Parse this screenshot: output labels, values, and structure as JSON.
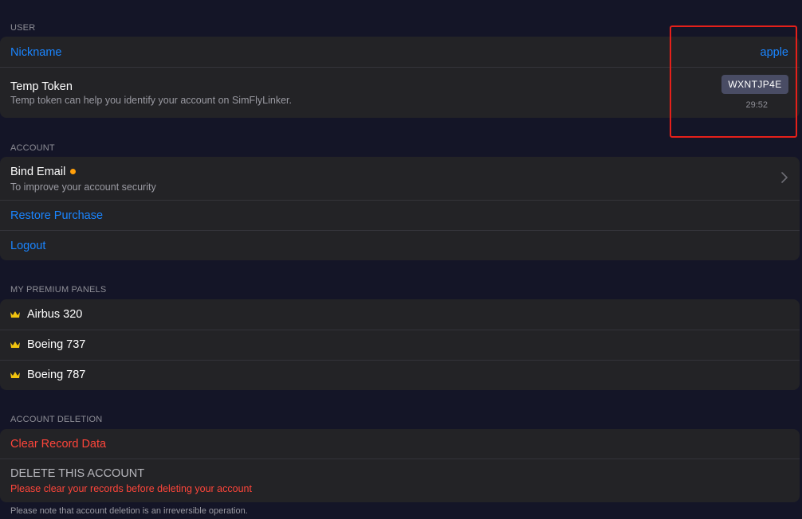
{
  "colors": {
    "background": "#141527",
    "group": "#232326",
    "accent_blue": "#1a85ff",
    "destructive_red": "#ff453a",
    "badge_orange": "#ff9f0a",
    "crown_gold": "#f2c40f",
    "highlight_box": "#e5201a"
  },
  "user_section": {
    "header": "USER",
    "nickname": {
      "label": "Nickname",
      "value": "apple"
    },
    "temp_token": {
      "title": "Temp Token",
      "description": "Temp token can help you identify your account on SimFlyLinker.",
      "token": "WXNTJP4E",
      "countdown": "29:52"
    }
  },
  "account_section": {
    "header": "ACCOUNT",
    "bind_email": {
      "title": "Bind Email",
      "description": "To improve your account security",
      "icon": "chevron-right-icon",
      "badge": "orange-dot"
    },
    "restore_purchase": "Restore Purchase",
    "logout": "Logout"
  },
  "premium_section": {
    "header": "MY PREMIUM PANELS",
    "icon": "crown-icon",
    "panels": [
      "Airbus 320",
      "Boeing 737",
      "Boeing 787"
    ]
  },
  "deletion_section": {
    "header": "ACCOUNT DELETION",
    "clear_record": "Clear Record Data",
    "delete_title": "DELETE THIS ACCOUNT",
    "delete_warning": "Please clear your records before deleting your account",
    "footnote": "Please note that account deletion is an irreversible operation."
  }
}
